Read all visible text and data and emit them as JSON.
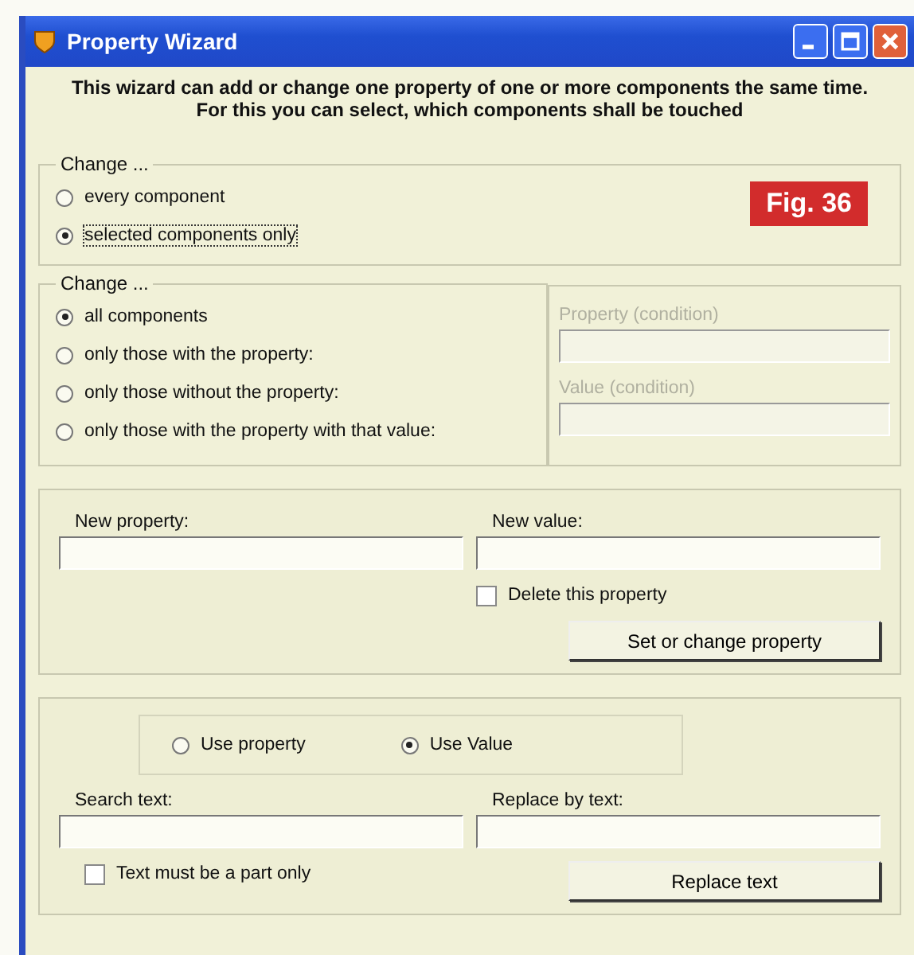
{
  "window": {
    "title": "Property Wizard"
  },
  "intro": [
    "This wizard can add or change one property of one or more components the same time.",
    "For this you can select, which components shall be touched"
  ],
  "figure_label": "Fig. 36",
  "scope_group": {
    "legend": "Change ...",
    "options": [
      {
        "label": "every component",
        "selected": false
      },
      {
        "label": "selected components only",
        "selected": true
      }
    ]
  },
  "filter_group": {
    "legend": "Change ...",
    "options": [
      {
        "label": "all components",
        "selected": true
      },
      {
        "label": "only those with the property:",
        "selected": false
      },
      {
        "label": "only those without the property:",
        "selected": false
      },
      {
        "label": "only those with the property with that value:",
        "selected": false
      }
    ],
    "fields": [
      {
        "label": "Property (condition)",
        "disabled": true
      },
      {
        "label": "Value (condition)",
        "disabled": true
      }
    ]
  },
  "set_group": {
    "fields": [
      {
        "label": "New property:"
      },
      {
        "label": "New value:"
      }
    ],
    "checkbox": {
      "label": "Delete this property",
      "checked": false
    },
    "button": "Set or change property"
  },
  "replace_group": {
    "modes": [
      {
        "label": "Use property",
        "selected": false
      },
      {
        "label": "Use Value",
        "selected": true
      }
    ],
    "fields": [
      {
        "label": "Search text:"
      },
      {
        "label": "Replace by text:"
      }
    ],
    "checkbox": {
      "label": "Text must be a part only",
      "checked": false
    },
    "button": "Replace text"
  }
}
